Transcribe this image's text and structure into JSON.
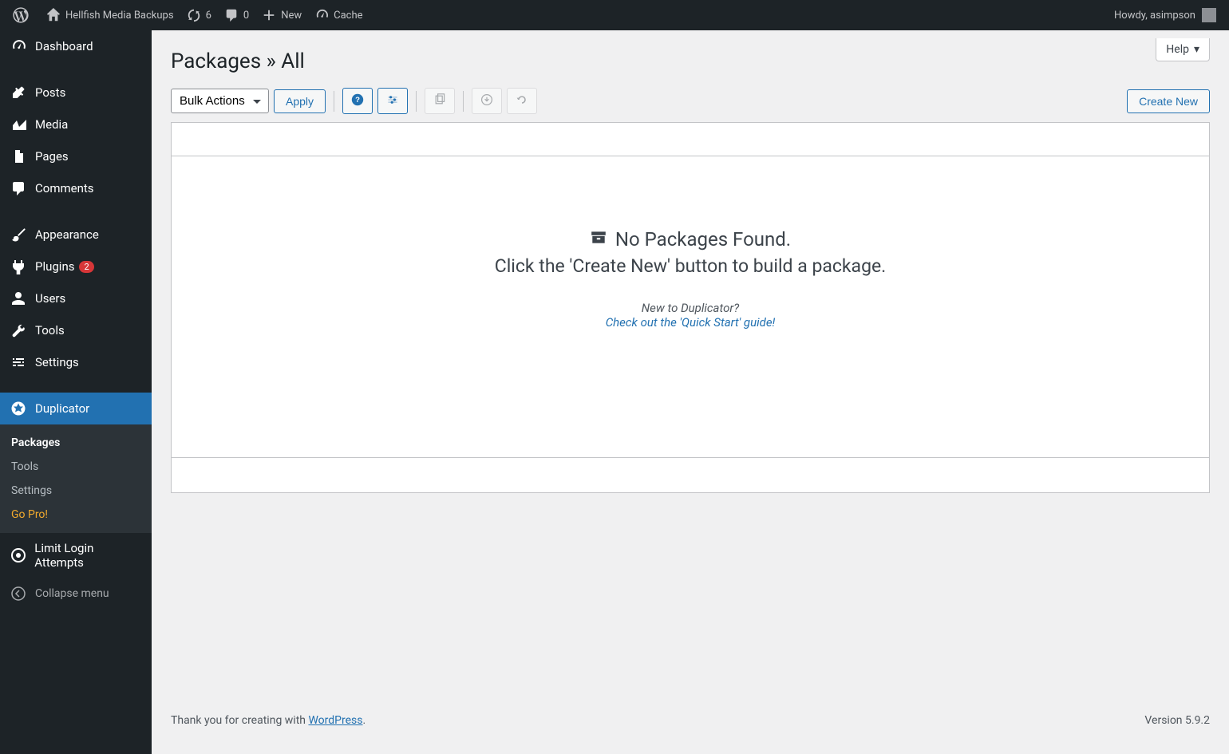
{
  "adminbar": {
    "site_name": "Hellfish Media Backups",
    "updates_count": "6",
    "comments_count": "0",
    "new_label": "New",
    "cache_label": "Cache",
    "howdy": "Howdy, asimpson"
  },
  "sidebar": {
    "items": [
      {
        "id": "dashboard",
        "label": "Dashboard"
      },
      {
        "id": "posts",
        "label": "Posts"
      },
      {
        "id": "media",
        "label": "Media"
      },
      {
        "id": "pages",
        "label": "Pages"
      },
      {
        "id": "comments",
        "label": "Comments"
      },
      {
        "id": "appearance",
        "label": "Appearance"
      },
      {
        "id": "plugins",
        "label": "Plugins",
        "badge": "2"
      },
      {
        "id": "users",
        "label": "Users"
      },
      {
        "id": "tools",
        "label": "Tools"
      },
      {
        "id": "settings",
        "label": "Settings"
      },
      {
        "id": "duplicator",
        "label": "Duplicator",
        "current": true
      },
      {
        "id": "limit-login",
        "label": "Limit Login Attempts"
      }
    ],
    "collapse_label": "Collapse menu",
    "submenu": [
      {
        "id": "packages",
        "label": "Packages",
        "current": true
      },
      {
        "id": "tools",
        "label": "Tools"
      },
      {
        "id": "settings",
        "label": "Settings"
      },
      {
        "id": "gopro",
        "label": "Go Pro!",
        "class": "gopro"
      }
    ]
  },
  "page": {
    "title": "Packages » All",
    "help_label": "Help",
    "bulk_actions": "Bulk Actions",
    "apply": "Apply",
    "create_new": "Create New",
    "no_packages": "No Packages Found.",
    "sub_line": "Click the 'Create New' button to build a package.",
    "new_line": "New to Duplicator?",
    "quick_start": "Check out the 'Quick Start' guide!"
  },
  "footer": {
    "thank_you_pre": "Thank you for creating with ",
    "wp_link": "WordPress",
    "thank_you_post": ".",
    "version": "Version 5.9.2"
  }
}
